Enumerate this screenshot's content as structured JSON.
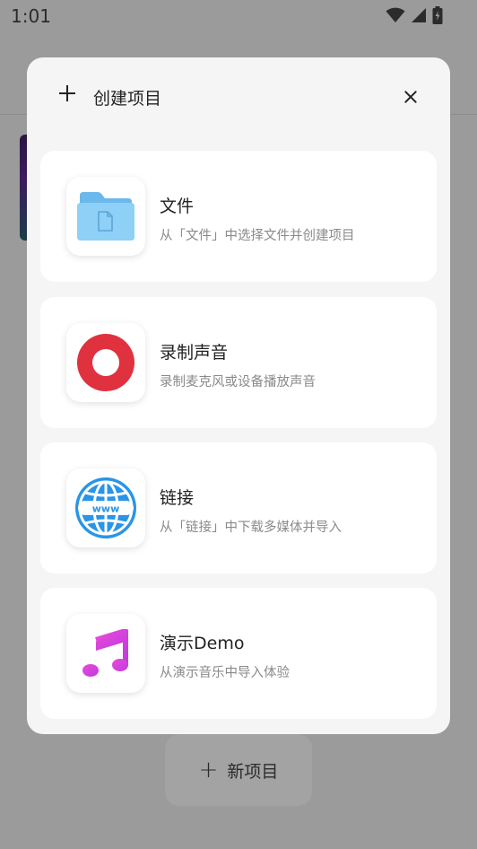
{
  "status_bar": {
    "time": "1:01"
  },
  "modal": {
    "title": "创建项目",
    "options": [
      {
        "title": "文件",
        "description": "从「文件」中选择文件并创建项目",
        "icon": "folder-icon"
      },
      {
        "title": "录制声音",
        "description": "录制麦克风或设备播放声音",
        "icon": "record-icon"
      },
      {
        "title": "链接",
        "description": "从「链接」中下载多媒体并导入",
        "icon": "globe-www-icon"
      },
      {
        "title": "演示Demo",
        "description": "从演示音乐中导入体验",
        "icon": "music-note-icon"
      }
    ]
  },
  "background": {
    "new_project_label": "新项目"
  },
  "colors": {
    "folder": "#86c9f3",
    "record": "#e0313f",
    "globe": "#2a94e6",
    "music": "#d944e0"
  }
}
